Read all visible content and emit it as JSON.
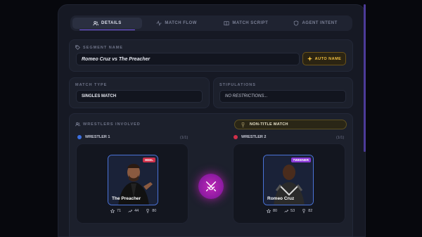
{
  "tabs": [
    {
      "label": "DETAILS",
      "icon": "users-icon",
      "active": true
    },
    {
      "label": "MATCH FLOW",
      "icon": "activity-icon",
      "active": false
    },
    {
      "label": "MATCH SCRIPT",
      "icon": "book-icon",
      "active": false
    },
    {
      "label": "AGENT INTENT",
      "icon": "shield-icon",
      "active": false
    }
  ],
  "segment": {
    "label": "SEGMENT NAME",
    "value": "Romeo Cruz vs The Preacher",
    "auto_name_label": "AUTO NAME"
  },
  "match_type": {
    "label": "MATCH TYPE",
    "value": "SINGLES MATCH"
  },
  "stipulations": {
    "label": "STIPULATIONS",
    "value": "NO RESTRICTIONS..."
  },
  "wrestlers": {
    "label": "WRESTLERS INVOLVED",
    "title_status": "NON-TITLE MATCH",
    "w1": {
      "label": "WRESTLER 1",
      "count": "(1/1)",
      "color": "#3b6fe0",
      "name": "The Preacher",
      "badge": "HEEL",
      "badge_color": "#d0304a",
      "stat_star": "71",
      "stat_trend": "44",
      "stat_trophy": "80"
    },
    "w2": {
      "label": "WRESTLER 2",
      "count": "(1/1)",
      "color": "#d0304a",
      "name": "Romeo Cruz",
      "badge": "TWEENER",
      "badge_color": "#8a3ad8",
      "stat_star": "80",
      "stat_trend": "53",
      "stat_trophy": "82"
    }
  },
  "colors": {
    "accent": "#7c5cf0",
    "gold": "#f2c040",
    "vs": "#c028b8"
  }
}
